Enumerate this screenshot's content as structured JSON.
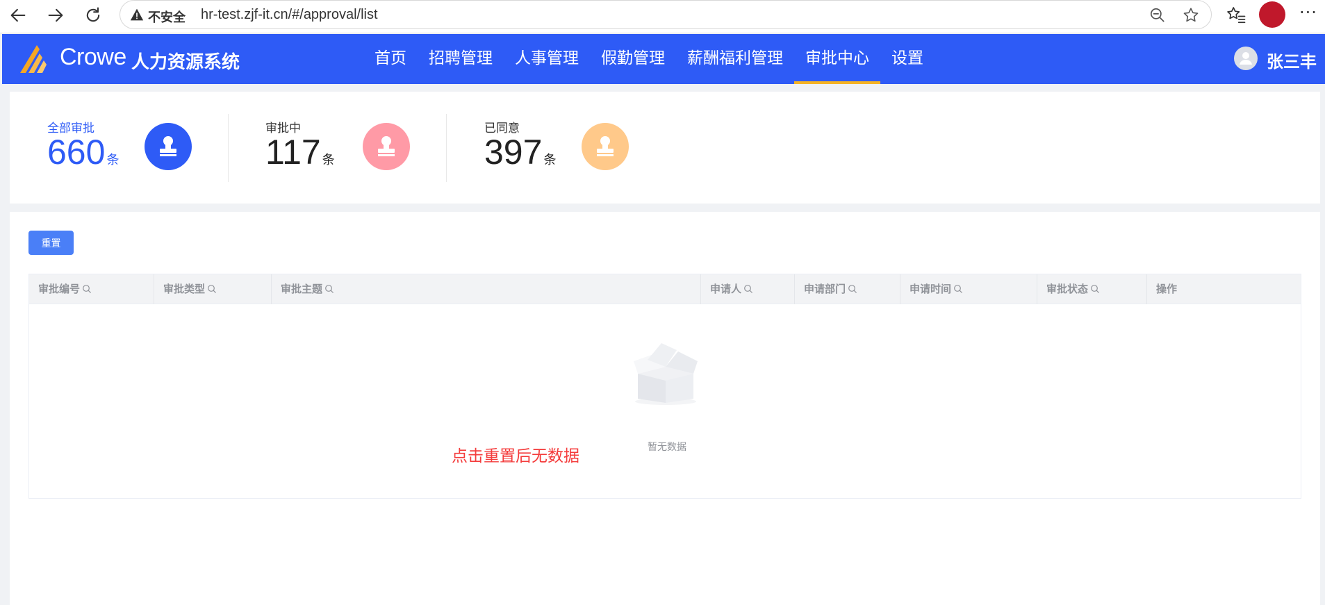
{
  "browser": {
    "security_label": "不安全",
    "url": "hr-test.zjf-it.cn/#/approval/list",
    "more_label": "···"
  },
  "header": {
    "logo_text": "Crowe",
    "system_name": "人力资源系统",
    "menu": [
      {
        "label": "首页",
        "active": false
      },
      {
        "label": "招聘管理",
        "active": false
      },
      {
        "label": "人事管理",
        "active": false
      },
      {
        "label": "假勤管理",
        "active": false
      },
      {
        "label": "薪酬福利管理",
        "active": false
      },
      {
        "label": "审批中心",
        "active": true
      },
      {
        "label": "设置",
        "active": false
      }
    ],
    "user_name": "张三丰",
    "brand_color": "#2e5bf6",
    "active_underline_color": "#f5b324"
  },
  "stats": [
    {
      "label": "全部审批",
      "value": "660",
      "unit": "条",
      "color": "#2e5bf6",
      "icon": "stamp-icon"
    },
    {
      "label": "审批中",
      "value": "117",
      "unit": "条",
      "color": "#ff9aa6",
      "icon": "stamp-icon"
    },
    {
      "label": "已同意",
      "value": "397",
      "unit": "条",
      "color": "#ffc98a",
      "icon": "stamp-icon"
    }
  ],
  "toolbar": {
    "reset_label": "重置"
  },
  "table": {
    "columns": [
      {
        "label": "审批编号",
        "searchable": true
      },
      {
        "label": "审批类型",
        "searchable": true
      },
      {
        "label": "审批主题",
        "searchable": true
      },
      {
        "label": "申请人",
        "searchable": true
      },
      {
        "label": "申请部门",
        "searchable": true
      },
      {
        "label": "申请时间",
        "searchable": true
      },
      {
        "label": "审批状态",
        "searchable": true
      },
      {
        "label": "操作",
        "searchable": false
      }
    ],
    "rows": [],
    "empty_text": "暂无数据"
  },
  "annotation": {
    "text": "点击重置后无数据",
    "color": "#f43c3c"
  }
}
